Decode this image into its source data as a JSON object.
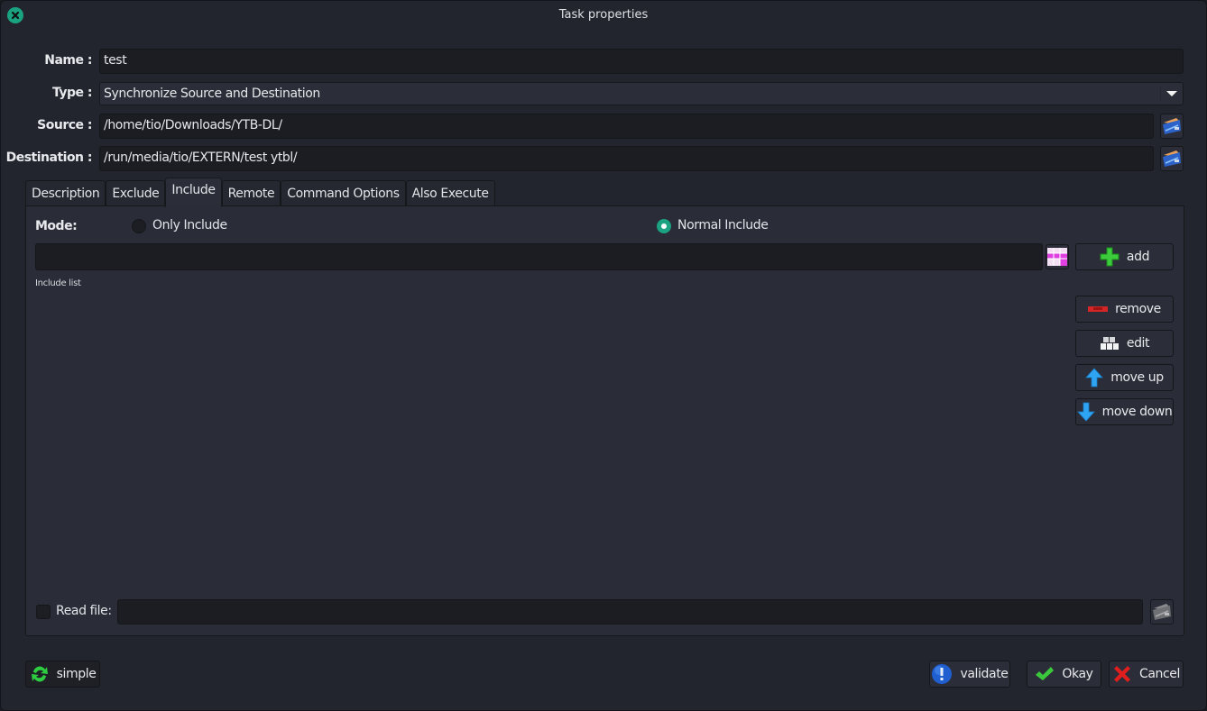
{
  "window": {
    "title": "Task properties",
    "close_icon": "close-icon"
  },
  "form": {
    "name": {
      "label": "Name :",
      "value": "test"
    },
    "type": {
      "label": "Type :",
      "selected": "Synchronize Source and Destination"
    },
    "source": {
      "label": "Source :",
      "value": "/home/tio/Downloads/YTB-DL/",
      "browse_icon": "folder-icon"
    },
    "destination": {
      "label": "Destination :",
      "value": "/run/media/tio/EXTERN/test ytbl/",
      "browse_icon": "folder-icon"
    }
  },
  "tabs": [
    {
      "label": "Description",
      "active": false
    },
    {
      "label": "Exclude",
      "active": false
    },
    {
      "label": "Include",
      "active": true
    },
    {
      "label": "Remote",
      "active": false
    },
    {
      "label": "Command Options",
      "active": false
    },
    {
      "label": "Also Execute",
      "active": false
    }
  ],
  "include_tab": {
    "mode_label": "Mode:",
    "modes": [
      {
        "label": "Only Include",
        "selected": false
      },
      {
        "label": "Normal Include",
        "selected": true
      }
    ],
    "pattern_input": {
      "value": "",
      "placeholder": ""
    },
    "pattern_icon": "pattern-grid-icon",
    "list_label": "Include list",
    "list_items": [],
    "buttons": {
      "add": "add",
      "remove": "remove",
      "edit": "edit",
      "move_up": "move up",
      "move_down": "move down"
    },
    "read_file": {
      "label": "Read file:",
      "checked": false,
      "value": ""
    }
  },
  "footer": {
    "simple": "simple",
    "validate": "validate",
    "okay": "Okay",
    "cancel": "Cancel"
  },
  "colors": {
    "accent": "#1aa281",
    "background": "#22252e",
    "panel": "#2a2d38",
    "field": "#1b1d22"
  }
}
